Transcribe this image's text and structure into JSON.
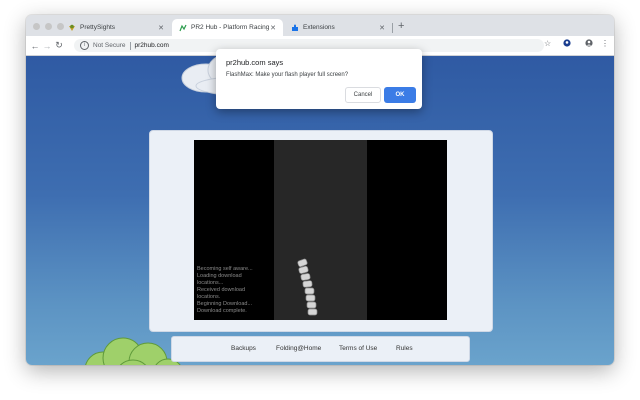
{
  "browser": {
    "tabs": [
      {
        "title": "PrettySights",
        "favicon": "prettysights-icon",
        "active": false
      },
      {
        "title": "PR2 Hub - Platform Racing 2",
        "favicon": "pr2-icon",
        "active": true
      },
      {
        "title": "Extensions",
        "favicon": "puzzle-icon",
        "active": false
      }
    ],
    "new_tab_label": "+",
    "address": {
      "security_label": "Not Secure",
      "url": "pr2hub.com"
    }
  },
  "dialog": {
    "title": "pr2hub.com says",
    "message": "FlashMax: Make your flash player full screen?",
    "cancel_label": "Cancel",
    "ok_label": "OK"
  },
  "game": {
    "log_lines": [
      "Becoming self aware...",
      "Loading download",
      "locations...",
      "Received download",
      "locations.",
      "Beginning Download...",
      "Download complete."
    ]
  },
  "footer": {
    "links": [
      "Backups",
      "Folding@Home",
      "Terms of Use",
      "Rules"
    ]
  },
  "colors": {
    "accent": "#3b7ce6",
    "sky_top": "#2f5aa3",
    "sky_bottom": "#6aa3cc",
    "panel": "#ebf0f7"
  }
}
